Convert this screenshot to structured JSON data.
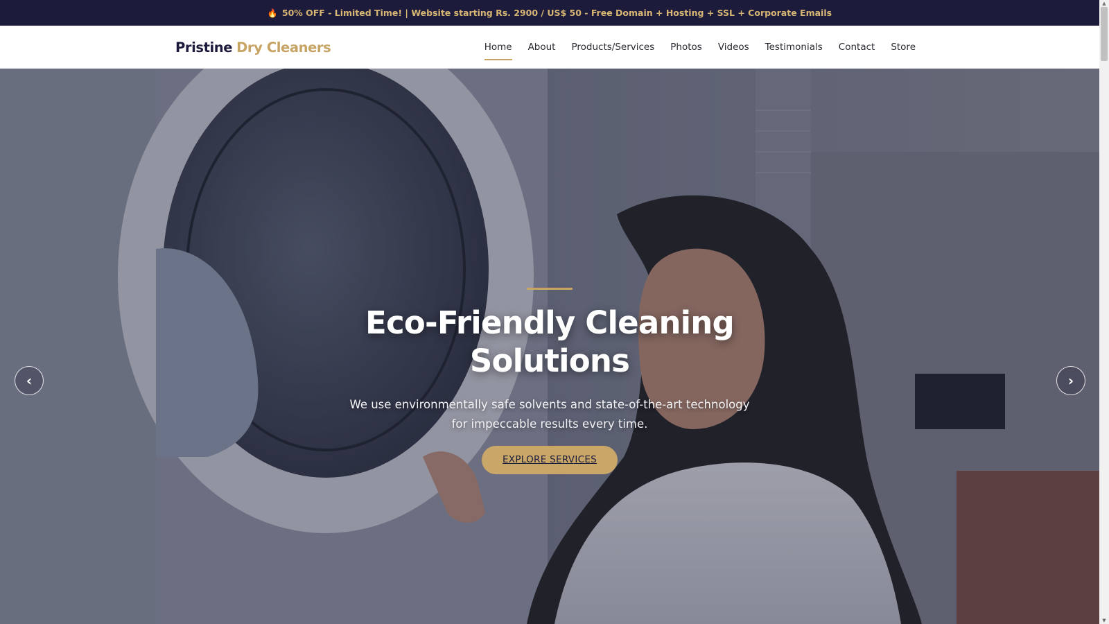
{
  "promo": {
    "icon": "fire-icon",
    "text": "50% OFF - Limited Time! | Website starting Rs. 2900 / US$ 50 - Free Domain + Hosting + SSL + Corporate Emails"
  },
  "brand": {
    "primary": "Pristine",
    "accent": "Dry Cleaners"
  },
  "nav": {
    "items": [
      {
        "label": "Home",
        "active": true
      },
      {
        "label": "About"
      },
      {
        "label": "Products/Services"
      },
      {
        "label": "Photos"
      },
      {
        "label": "Videos"
      },
      {
        "label": "Testimonials"
      },
      {
        "label": "Contact"
      },
      {
        "label": "Store"
      }
    ]
  },
  "hero": {
    "title": "Eco-Friendly Cleaning Solutions",
    "subtitle": "We use environmentally safe solvents and state-of-the-art technology for impeccable results every time.",
    "cta_label": "EXPLORE SERVICES",
    "prev_glyph": "‹",
    "next_glyph": "›",
    "prev_icon": "chevron-left-icon",
    "next_icon": "chevron-right-icon"
  },
  "colors": {
    "promo_bg": "#1c1b3c",
    "accent_gold": "#c7a464",
    "navy_text": "#1c1b3c"
  }
}
